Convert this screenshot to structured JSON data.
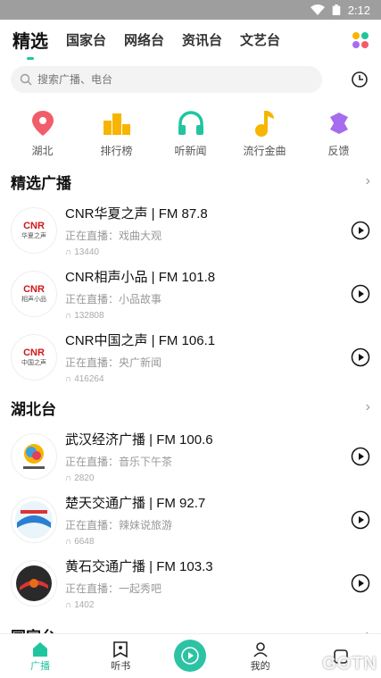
{
  "status": {
    "time": "2:12"
  },
  "tabs": [
    "精选",
    "国家台",
    "网络台",
    "资讯台",
    "文艺台"
  ],
  "search": {
    "placeholder": "搜索广播、电台"
  },
  "shortcuts": [
    {
      "label": "湖北",
      "icon": "location-pin-icon",
      "color": "#f25d6b"
    },
    {
      "label": "排行榜",
      "icon": "podium-icon",
      "color": "#f7b500"
    },
    {
      "label": "听新闻",
      "icon": "headphones-icon",
      "color": "#20c5a0"
    },
    {
      "label": "流行金曲",
      "icon": "music-note-icon",
      "color": "#f7b500"
    },
    {
      "label": "反馈",
      "icon": "feedback-icon",
      "color": "#a66cf0"
    }
  ],
  "sections": [
    {
      "title": "精选广播",
      "stations": [
        {
          "name": "CNR华夏之声 | FM 87.8",
          "live": "正在直播：戏曲大观",
          "count": "13440",
          "logo_text": "华夏之声"
        },
        {
          "name": "CNR相声小品 | FM 101.8",
          "live": "正在直播：小品故事",
          "count": "132808",
          "logo_text": "相声小品"
        },
        {
          "name": "CNR中国之声 | FM 106.1",
          "live": "正在直播：央广新闻",
          "count": "416264",
          "logo_text": "中国之声"
        }
      ]
    },
    {
      "title": "湖北台",
      "stations": [
        {
          "name": "武汉经济广播 | FM 100.6",
          "live": "正在直播：音乐下午茶",
          "count": "2820",
          "logo_text": ""
        },
        {
          "name": "楚天交通广播 | FM 92.7",
          "live": "正在直播：辣妹说旅游",
          "count": "6648",
          "logo_text": ""
        },
        {
          "name": "黄石交通广播 | FM 103.3",
          "live": "正在直播：一起秀吧",
          "count": "1402",
          "logo_text": ""
        }
      ]
    },
    {
      "title": "国家台"
    }
  ],
  "bottom_nav": {
    "broadcast": "广播",
    "books": "听书",
    "mine": "我的"
  },
  "watermark": "GOTN",
  "colors": {
    "accent": "#20c5a0"
  }
}
